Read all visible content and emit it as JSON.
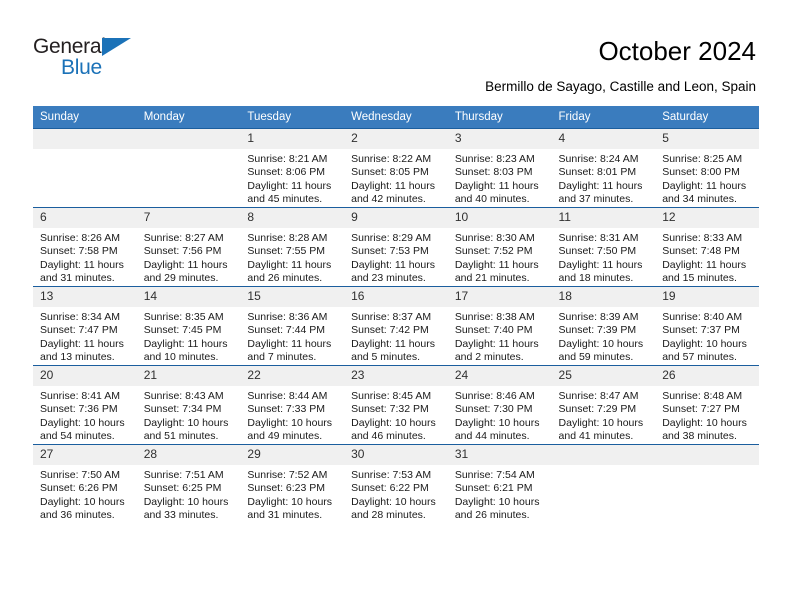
{
  "brand": {
    "name_dark": "General",
    "name_blue": "Blue",
    "accent_color": "#1b72b8"
  },
  "header": {
    "title": "October 2024",
    "subtitle": "Bermillo de Sayago, Castille and Leon, Spain"
  },
  "theme": {
    "header_row_bg": "#3a7cbe",
    "daynum_bg": "#f0f0f0",
    "row_border": "#1b5e9e"
  },
  "labels": {
    "sunrise_prefix": "Sunrise:",
    "sunset_prefix": "Sunset:",
    "daylight_prefix": "Daylight:"
  },
  "weekday_headers": [
    "Sunday",
    "Monday",
    "Tuesday",
    "Wednesday",
    "Thursday",
    "Friday",
    "Saturday"
  ],
  "weeks": [
    [
      {
        "day": "",
        "sunrise": "",
        "sunset": "",
        "daylight_1": "",
        "daylight_2": ""
      },
      {
        "day": "",
        "sunrise": "",
        "sunset": "",
        "daylight_1": "",
        "daylight_2": ""
      },
      {
        "day": "1",
        "sunrise": "Sunrise: 8:21 AM",
        "sunset": "Sunset: 8:06 PM",
        "daylight_1": "Daylight: 11 hours",
        "daylight_2": "and 45 minutes."
      },
      {
        "day": "2",
        "sunrise": "Sunrise: 8:22 AM",
        "sunset": "Sunset: 8:05 PM",
        "daylight_1": "Daylight: 11 hours",
        "daylight_2": "and 42 minutes."
      },
      {
        "day": "3",
        "sunrise": "Sunrise: 8:23 AM",
        "sunset": "Sunset: 8:03 PM",
        "daylight_1": "Daylight: 11 hours",
        "daylight_2": "and 40 minutes."
      },
      {
        "day": "4",
        "sunrise": "Sunrise: 8:24 AM",
        "sunset": "Sunset: 8:01 PM",
        "daylight_1": "Daylight: 11 hours",
        "daylight_2": "and 37 minutes."
      },
      {
        "day": "5",
        "sunrise": "Sunrise: 8:25 AM",
        "sunset": "Sunset: 8:00 PM",
        "daylight_1": "Daylight: 11 hours",
        "daylight_2": "and 34 minutes."
      }
    ],
    [
      {
        "day": "6",
        "sunrise": "Sunrise: 8:26 AM",
        "sunset": "Sunset: 7:58 PM",
        "daylight_1": "Daylight: 11 hours",
        "daylight_2": "and 31 minutes."
      },
      {
        "day": "7",
        "sunrise": "Sunrise: 8:27 AM",
        "sunset": "Sunset: 7:56 PM",
        "daylight_1": "Daylight: 11 hours",
        "daylight_2": "and 29 minutes."
      },
      {
        "day": "8",
        "sunrise": "Sunrise: 8:28 AM",
        "sunset": "Sunset: 7:55 PM",
        "daylight_1": "Daylight: 11 hours",
        "daylight_2": "and 26 minutes."
      },
      {
        "day": "9",
        "sunrise": "Sunrise: 8:29 AM",
        "sunset": "Sunset: 7:53 PM",
        "daylight_1": "Daylight: 11 hours",
        "daylight_2": "and 23 minutes."
      },
      {
        "day": "10",
        "sunrise": "Sunrise: 8:30 AM",
        "sunset": "Sunset: 7:52 PM",
        "daylight_1": "Daylight: 11 hours",
        "daylight_2": "and 21 minutes."
      },
      {
        "day": "11",
        "sunrise": "Sunrise: 8:31 AM",
        "sunset": "Sunset: 7:50 PM",
        "daylight_1": "Daylight: 11 hours",
        "daylight_2": "and 18 minutes."
      },
      {
        "day": "12",
        "sunrise": "Sunrise: 8:33 AM",
        "sunset": "Sunset: 7:48 PM",
        "daylight_1": "Daylight: 11 hours",
        "daylight_2": "and 15 minutes."
      }
    ],
    [
      {
        "day": "13",
        "sunrise": "Sunrise: 8:34 AM",
        "sunset": "Sunset: 7:47 PM",
        "daylight_1": "Daylight: 11 hours",
        "daylight_2": "and 13 minutes."
      },
      {
        "day": "14",
        "sunrise": "Sunrise: 8:35 AM",
        "sunset": "Sunset: 7:45 PM",
        "daylight_1": "Daylight: 11 hours",
        "daylight_2": "and 10 minutes."
      },
      {
        "day": "15",
        "sunrise": "Sunrise: 8:36 AM",
        "sunset": "Sunset: 7:44 PM",
        "daylight_1": "Daylight: 11 hours",
        "daylight_2": "and 7 minutes."
      },
      {
        "day": "16",
        "sunrise": "Sunrise: 8:37 AM",
        "sunset": "Sunset: 7:42 PM",
        "daylight_1": "Daylight: 11 hours",
        "daylight_2": "and 5 minutes."
      },
      {
        "day": "17",
        "sunrise": "Sunrise: 8:38 AM",
        "sunset": "Sunset: 7:40 PM",
        "daylight_1": "Daylight: 11 hours",
        "daylight_2": "and 2 minutes."
      },
      {
        "day": "18",
        "sunrise": "Sunrise: 8:39 AM",
        "sunset": "Sunset: 7:39 PM",
        "daylight_1": "Daylight: 10 hours",
        "daylight_2": "and 59 minutes."
      },
      {
        "day": "19",
        "sunrise": "Sunrise: 8:40 AM",
        "sunset": "Sunset: 7:37 PM",
        "daylight_1": "Daylight: 10 hours",
        "daylight_2": "and 57 minutes."
      }
    ],
    [
      {
        "day": "20",
        "sunrise": "Sunrise: 8:41 AM",
        "sunset": "Sunset: 7:36 PM",
        "daylight_1": "Daylight: 10 hours",
        "daylight_2": "and 54 minutes."
      },
      {
        "day": "21",
        "sunrise": "Sunrise: 8:43 AM",
        "sunset": "Sunset: 7:34 PM",
        "daylight_1": "Daylight: 10 hours",
        "daylight_2": "and 51 minutes."
      },
      {
        "day": "22",
        "sunrise": "Sunrise: 8:44 AM",
        "sunset": "Sunset: 7:33 PM",
        "daylight_1": "Daylight: 10 hours",
        "daylight_2": "and 49 minutes."
      },
      {
        "day": "23",
        "sunrise": "Sunrise: 8:45 AM",
        "sunset": "Sunset: 7:32 PM",
        "daylight_1": "Daylight: 10 hours",
        "daylight_2": "and 46 minutes."
      },
      {
        "day": "24",
        "sunrise": "Sunrise: 8:46 AM",
        "sunset": "Sunset: 7:30 PM",
        "daylight_1": "Daylight: 10 hours",
        "daylight_2": "and 44 minutes."
      },
      {
        "day": "25",
        "sunrise": "Sunrise: 8:47 AM",
        "sunset": "Sunset: 7:29 PM",
        "daylight_1": "Daylight: 10 hours",
        "daylight_2": "and 41 minutes."
      },
      {
        "day": "26",
        "sunrise": "Sunrise: 8:48 AM",
        "sunset": "Sunset: 7:27 PM",
        "daylight_1": "Daylight: 10 hours",
        "daylight_2": "and 38 minutes."
      }
    ],
    [
      {
        "day": "27",
        "sunrise": "Sunrise: 7:50 AM",
        "sunset": "Sunset: 6:26 PM",
        "daylight_1": "Daylight: 10 hours",
        "daylight_2": "and 36 minutes."
      },
      {
        "day": "28",
        "sunrise": "Sunrise: 7:51 AM",
        "sunset": "Sunset: 6:25 PM",
        "daylight_1": "Daylight: 10 hours",
        "daylight_2": "and 33 minutes."
      },
      {
        "day": "29",
        "sunrise": "Sunrise: 7:52 AM",
        "sunset": "Sunset: 6:23 PM",
        "daylight_1": "Daylight: 10 hours",
        "daylight_2": "and 31 minutes."
      },
      {
        "day": "30",
        "sunrise": "Sunrise: 7:53 AM",
        "sunset": "Sunset: 6:22 PM",
        "daylight_1": "Daylight: 10 hours",
        "daylight_2": "and 28 minutes."
      },
      {
        "day": "31",
        "sunrise": "Sunrise: 7:54 AM",
        "sunset": "Sunset: 6:21 PM",
        "daylight_1": "Daylight: 10 hours",
        "daylight_2": "and 26 minutes."
      },
      {
        "day": "",
        "sunrise": "",
        "sunset": "",
        "daylight_1": "",
        "daylight_2": ""
      },
      {
        "day": "",
        "sunrise": "",
        "sunset": "",
        "daylight_1": "",
        "daylight_2": ""
      }
    ]
  ]
}
